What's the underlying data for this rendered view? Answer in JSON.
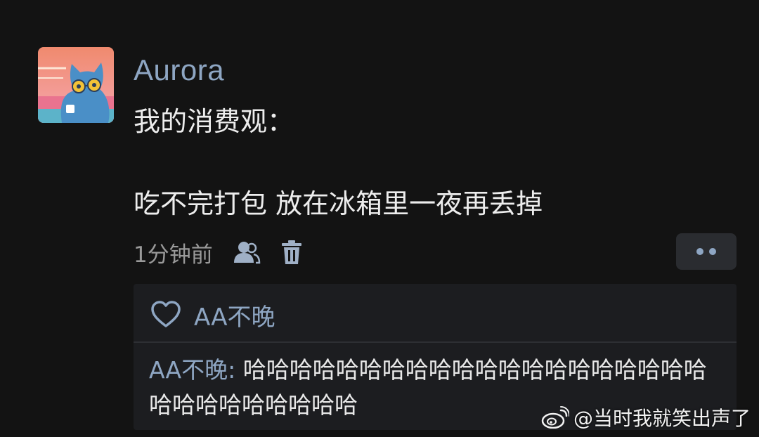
{
  "post": {
    "username": "Aurora",
    "line1": "我的消费观：",
    "line2": "吃不完打包 放在冰箱里一夜再丢掉",
    "time": "1分钟前"
  },
  "icons": {
    "avatar": "cartoon-cat-avatar",
    "friends": "friends-icon",
    "delete": "trash-icon",
    "more": "more-dots-icon",
    "like": "heart-outline-icon",
    "watermark": "weibo-logo-icon"
  },
  "likes": {
    "names": "AA不晚"
  },
  "comments": [
    {
      "author": "AA不晚",
      "separator": ": ",
      "text": "哈哈哈哈哈哈哈哈哈哈哈哈哈哈哈哈哈哈哈哈哈哈哈哈哈哈哈哈哈"
    }
  ],
  "watermark": {
    "text": "@当时我就笑出声了"
  },
  "colors": {
    "background": "#131313",
    "username": "#8ea6c3",
    "panel": "#1c1d20"
  }
}
